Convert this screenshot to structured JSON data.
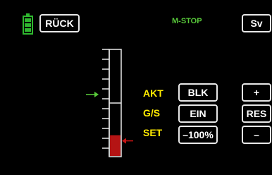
{
  "header": {
    "back_label": "RÜCK",
    "status_label": "M-STOP",
    "sv_label": "Sv"
  },
  "rows": [
    {
      "label": "AKT",
      "value": "BLK",
      "side_button": "+"
    },
    {
      "label": "G/S",
      "value": "EIN",
      "side_button": "RES"
    },
    {
      "label": "SET",
      "value": "–100%",
      "side_button": "–"
    }
  ],
  "throttle": {
    "set_level": 0.2,
    "akt_level": 0.58
  },
  "colors": {
    "label": "#ffeb00",
    "status": "#58c93a",
    "akt_arrow": "#58c93a",
    "set_arrow": "#c81414",
    "bar_fill": "#b41414",
    "battery": "#2fb82f"
  },
  "icons": {
    "battery": "battery-icon",
    "akt_marker": "arrow-right-icon",
    "set_marker": "arrow-left-icon"
  }
}
